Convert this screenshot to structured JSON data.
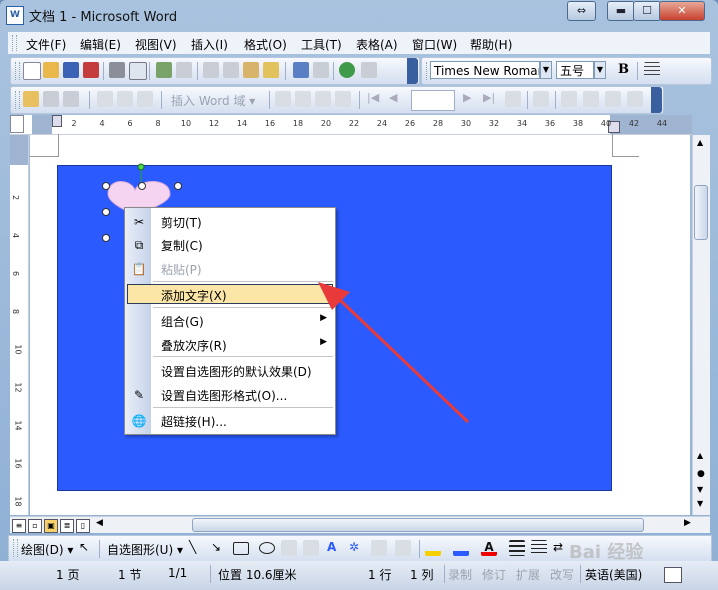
{
  "window": {
    "title": "文档 1 - Microsoft Word",
    "app_icon": "W",
    "buttons": {
      "restore": "⇔",
      "minimize": "▬",
      "maximize": "☐",
      "close": "✕"
    }
  },
  "menubar": [
    "文件(F)",
    "编辑(E)",
    "视图(V)",
    "插入(I)",
    "格式(O)",
    "工具(T)",
    "表格(A)",
    "窗口(W)",
    "帮助(H)"
  ],
  "standard_toolbar": {
    "font_name": "Times New Roman",
    "font_size": "五号",
    "bold": "B"
  },
  "mailmerge_toolbar": {
    "insert_field": "插入 Word 域 ▾"
  },
  "ruler": {
    "ticks": [
      "2",
      "4",
      "6",
      "8",
      "10",
      "12",
      "14",
      "16",
      "18",
      "20",
      "22",
      "24",
      "26",
      "28",
      "30",
      "32",
      "34",
      "36",
      "38",
      "40",
      "42",
      "44"
    ]
  },
  "vruler": {
    "ticks": [
      "2",
      "4",
      "6",
      "8",
      "10",
      "12",
      "14",
      "16",
      "18"
    ]
  },
  "context_menu": {
    "items": [
      {
        "label": "剪切(T)",
        "icon": "scissors-icon",
        "glyph": "✂",
        "disabled": false
      },
      {
        "label": "复制(C)",
        "icon": "copy-icon",
        "glyph": "⧉",
        "disabled": false
      },
      {
        "label": "粘贴(P)",
        "icon": "paste-icon",
        "glyph": "📋",
        "disabled": true
      },
      {
        "label": "添加文字(X)",
        "highlighted": true
      },
      {
        "label": "组合(G)",
        "submenu": true
      },
      {
        "label": "叠放次序(R)",
        "submenu": true
      },
      {
        "label": "设置自选图形的默认效果(D)"
      },
      {
        "label": "设置自选图形格式(O)...",
        "icon": "format-shape-icon",
        "glyph": "✎"
      },
      {
        "label": "超链接(H)...",
        "icon": "hyperlink-icon",
        "glyph": "🌐"
      }
    ]
  },
  "drawing_toolbar": {
    "draw": "绘图(D) ▾",
    "autoshapes": "自选图形(U) ▾"
  },
  "statusbar": {
    "page": "1 页",
    "section": "1 节",
    "page_of": "1/1",
    "position": "位置 10.6厘米",
    "line": "1 行",
    "column": "1 列",
    "rec": "录制",
    "trk": "修订",
    "ext": "扩展",
    "ovr": "改写",
    "lang": "英语(美国)"
  },
  "watermark": "Bai 经验",
  "colors": {
    "canvas": "#2b5bff",
    "highlight": "#fbe5a7",
    "arrow": "#e83a3a"
  }
}
